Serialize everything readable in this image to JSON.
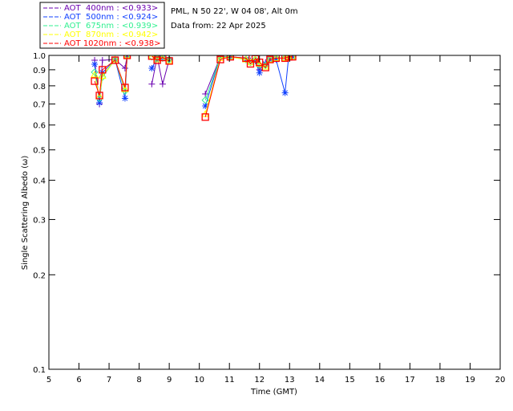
{
  "chart_data": {
    "type": "scatter",
    "title_lines": [
      "PML, N 50 22', W 04 08', Alt 0m",
      "Data from: 22 Apr 2025"
    ],
    "xlabel": "Time (GMT)",
    "ylabel": "Single Scattering Albedo (ω)",
    "xlim": [
      5,
      20
    ],
    "ylim": [
      0.1,
      1.0
    ],
    "yscale": "log",
    "x_ticks": [
      "5",
      "6",
      "7",
      "8",
      "9",
      "10",
      "11",
      "12",
      "13",
      "14",
      "15",
      "16",
      "17",
      "18",
      "19",
      "20"
    ],
    "y_ticks": [
      {
        "v": 1.0,
        "label": "1.0"
      },
      {
        "v": 0.9,
        "label": "0.9"
      },
      {
        "v": 0.8,
        "label": "0.8"
      },
      {
        "v": 0.7,
        "label": "0.7"
      },
      {
        "v": 0.6,
        "label": "0.6"
      },
      {
        "v": 0.5,
        "label": "0.5"
      },
      {
        "v": 0.4,
        "label": "0.4"
      },
      {
        "v": 0.3,
        "label": "0.3"
      },
      {
        "v": 0.2,
        "label": "0.2"
      },
      {
        "v": 0.1,
        "label": "0.1"
      }
    ],
    "grid": false,
    "legend_placement": "top-left",
    "x": [
      6.52,
      6.68,
      6.78,
      7.2,
      7.53,
      7.6,
      8.42,
      8.6,
      8.78,
      9.0,
      10.2,
      10.7,
      11.03,
      11.55,
      11.7,
      11.86,
      12.0,
      12.2,
      12.35,
      12.55,
      12.85,
      12.97,
      13.1
    ],
    "series": [
      {
        "name": "AOT  400nm : <0.933>",
        "color": "#6a00b0",
        "marker": "plus",
        "values": [
          0.965,
          0.7,
          0.965,
          0.97,
          0.91,
          1.0,
          0.81,
          0.99,
          0.81,
          0.97,
          0.754,
          0.99,
          0.99,
          0.98,
          0.96,
          0.97,
          0.9,
          0.95,
          0.98,
          0.98,
          0.98,
          0.99,
          0.99
        ]
      },
      {
        "name": "AOT  500nm : <0.924>",
        "color": "#1040ff",
        "marker": "asterisk",
        "values": [
          0.937,
          0.707,
          0.88,
          0.97,
          0.73,
          1.0,
          0.91,
          0.98,
          0.98,
          0.97,
          0.69,
          0.99,
          0.99,
          0.97,
          0.96,
          0.96,
          0.88,
          0.94,
          0.97,
          0.97,
          0.76,
          0.99,
          0.99
        ]
      },
      {
        "name": "AOT  675nm : <0.939>",
        "color": "#30f090",
        "marker": "diamond",
        "values": [
          0.884,
          0.73,
          0.853,
          0.97,
          0.77,
          1.0,
          0.99,
          0.98,
          0.98,
          0.97,
          0.72,
          0.99,
          0.99,
          0.97,
          0.95,
          0.97,
          0.93,
          0.93,
          0.97,
          0.98,
          0.98,
          0.99,
          0.99
        ]
      },
      {
        "name": "AOT  870nm : <0.942>",
        "color": "#ffff00",
        "marker": "triangle",
        "values": [
          0.868,
          0.74,
          0.86,
          0.97,
          0.78,
          1.0,
          0.99,
          0.97,
          0.98,
          0.96,
          0.65,
          0.98,
          0.99,
          0.97,
          0.95,
          0.97,
          0.94,
          0.92,
          0.97,
          0.98,
          0.98,
          0.99,
          0.99
        ]
      },
      {
        "name": "AOT 1020nm : <0.938>",
        "color": "#ff0000",
        "marker": "square",
        "values": [
          0.828,
          0.745,
          0.9,
          0.965,
          0.79,
          1.0,
          0.995,
          0.965,
          0.985,
          0.96,
          0.636,
          0.97,
          0.99,
          0.98,
          0.94,
          0.975,
          0.95,
          0.915,
          0.97,
          0.98,
          0.98,
          0.99,
          0.99
        ]
      }
    ]
  }
}
